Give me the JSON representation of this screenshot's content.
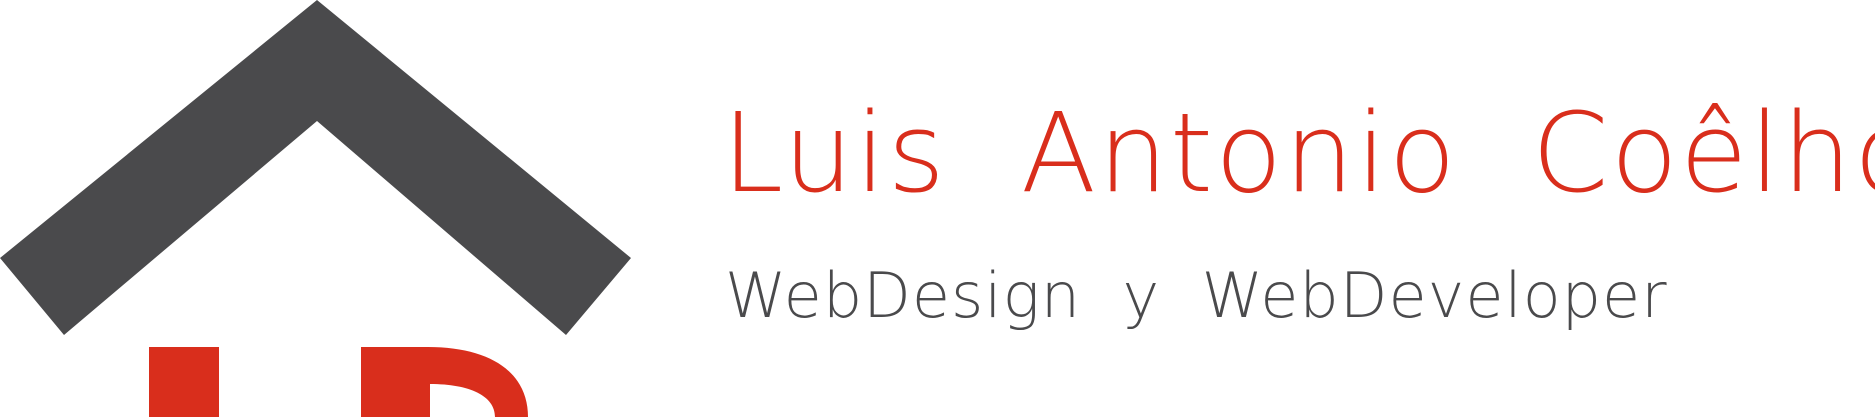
{
  "brand": {
    "name": "Luis  Antonio  Coêlho",
    "tagline": "WebDesign  y  WebDeveloper"
  },
  "colors": {
    "accent_red": "#d92e1c",
    "charcoal": "#4a4a4c",
    "background": "#ffffff"
  },
  "logo": {
    "icon": "house-roof-logo-icon"
  }
}
